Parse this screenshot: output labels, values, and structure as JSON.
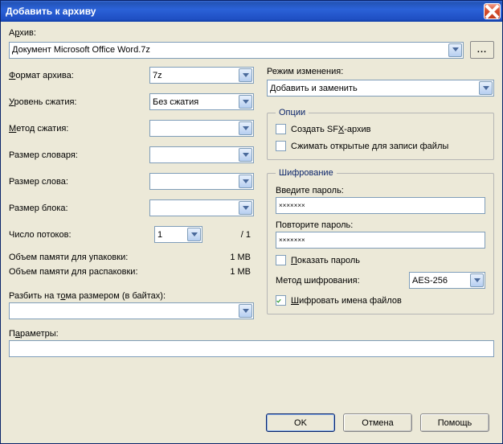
{
  "window": {
    "title": "Добавить к архиву"
  },
  "archive": {
    "label_pre": "А",
    "label_u": "р",
    "label_post": "хив:",
    "value": "Документ Microsoft Office Word.7z",
    "browse": "..."
  },
  "left": {
    "format": {
      "pre": "",
      "u": "Ф",
      "post": "ормат архива:",
      "value": "7z"
    },
    "level": {
      "pre": "",
      "u": "У",
      "post": "ровень сжатия:",
      "value": "Без сжатия"
    },
    "method": {
      "pre": "",
      "u": "М",
      "post": "етод сжатия:",
      "value": ""
    },
    "dict": {
      "label": "Размер словаря:",
      "value": ""
    },
    "word": {
      "label": "Размер слова:",
      "value": ""
    },
    "block": {
      "label": "Размер блока:",
      "value": ""
    },
    "threads": {
      "label": "Число потоков:",
      "value": "1",
      "suffix": "/ 1"
    },
    "mem_pack": {
      "label": "Объем памяти для упаковки:",
      "value": "1 MB"
    },
    "mem_unpack": {
      "label": "Объем памяти для распаковки:",
      "value": "1 MB"
    },
    "split": {
      "pre": "Разбить на т",
      "u": "о",
      "post": "ма размером (в байтах):",
      "value": ""
    }
  },
  "right": {
    "mode": {
      "label": "Режим изменения:",
      "value": "Добавить и заменить"
    },
    "options": {
      "legend": "Опции",
      "sfx": {
        "pre": "Создать SF",
        "u": "X",
        "post": "-архив",
        "checked": false
      },
      "open_files": {
        "label": "Сжимать открытые для записи файлы",
        "checked": false
      }
    },
    "encryption": {
      "legend": "Шифрование",
      "pw1_label": "Введите пароль:",
      "pw1": "×××××××",
      "pw2_label": "Повторите пароль:",
      "pw2": "×××××××",
      "show_pw": {
        "pre": "",
        "u": "П",
        "post": "оказать пароль",
        "checked": false
      },
      "method_label": "Метод шифрования:",
      "method_value": "AES-256",
      "encrypt_names": {
        "pre": "",
        "u": "Ш",
        "post": "ифровать имена файлов",
        "checked": true
      }
    }
  },
  "params": {
    "pre": "П",
    "u": "а",
    "post": "раметры:",
    "value": ""
  },
  "buttons": {
    "ok": "OK",
    "cancel": "Отмена",
    "help": "Помощь"
  }
}
